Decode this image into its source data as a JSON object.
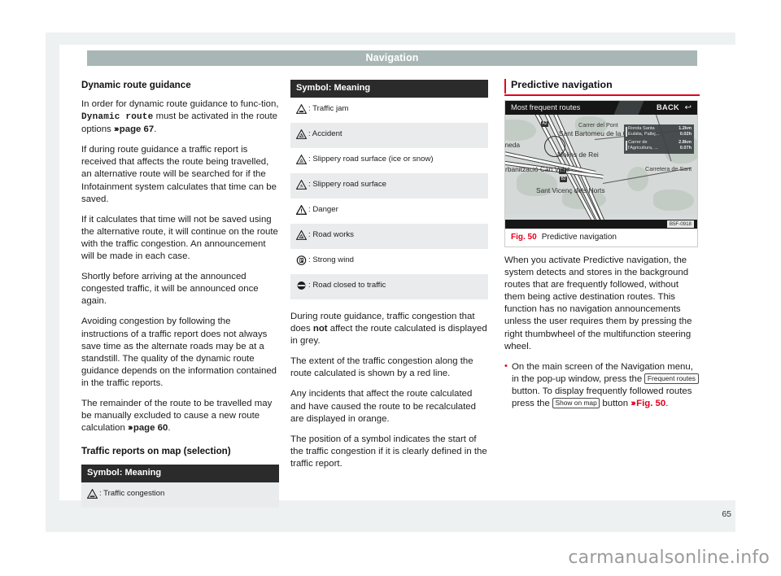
{
  "header": {
    "title": "Navigation"
  },
  "page_number": "65",
  "watermark": "carmanualsonline.info",
  "left_column": {
    "heading": "Dynamic route guidance",
    "para1_a": "In order for dynamic route guidance to func-tion, ",
    "para1_mono": "Dynamic route",
    "para1_b": " must be activated in the route options ",
    "para1_ref": "page 67",
    "para1_end": ".",
    "para2": "If during route guidance a traffic report is received that affects the route being travelled, an alternative route will be searched for if the Infotainment system calculates that time can be saved.",
    "para3": "If it calculates that time will not be saved using the alternative route, it will continue on the route with the traffic congestion. An announcement will be made in each case.",
    "para4": "Shortly before arriving at the announced congested traffic, it will be announced once again.",
    "para5": "Avoiding congestion by following the instructions of a traffic report does not always save time as the alternate roads may be at a standstill. The quality of the dynamic route guidance depends on the information contained in the traffic reports.",
    "para6_a": "The remainder of the route to be travelled may be manually excluded to cause a new route calculation ",
    "para6_ref": "page 60",
    "para6_end": ".",
    "table_heading": "Traffic reports on map (selection)",
    "table": {
      "header": "Symbol: Meaning",
      "rows": [
        {
          "icon": "warning-triangle-congestion-icon",
          "label": ": Traffic congestion"
        }
      ]
    }
  },
  "middle_column": {
    "table": {
      "header": "Symbol: Meaning",
      "rows": [
        {
          "icon": "warning-triangle-traffic-jam-icon",
          "label": ": Traffic jam"
        },
        {
          "icon": "warning-triangle-accident-icon",
          "label": ": Accident"
        },
        {
          "icon": "warning-triangle-ice-snow-icon",
          "label": ": Slippery road surface (ice or snow)"
        },
        {
          "icon": "warning-triangle-slippery-icon",
          "label": ": Slippery road surface"
        },
        {
          "icon": "warning-triangle-danger-icon",
          "label": ": Danger"
        },
        {
          "icon": "warning-triangle-road-works-icon",
          "label": ": Road works"
        },
        {
          "icon": "strong-wind-icon",
          "label": ": Strong wind"
        },
        {
          "icon": "road-closed-icon",
          "label": ": Road closed to traffic"
        }
      ]
    },
    "para1_a": "During route guidance, traffic congestion that does ",
    "para1_bold": "not",
    "para1_b": " affect the route calculated is displayed in grey.",
    "para2": "The extent of the traffic congestion along the route calculated is shown by a red line.",
    "para3": "Any incidents that affect the route calculated and have caused the route to be recalculated are displayed in orange.",
    "para4": "The position of a symbol indicates the start of the traffic congestion if it is clearly defined in the traffic report."
  },
  "right_column": {
    "heading": "Predictive navigation",
    "figure": {
      "screen_title": "Most frequent routes",
      "back_label": "BACK",
      "back_icon": "back-arrow-icon",
      "image_id": "B5F-0918",
      "caption_number": "Fig. 50",
      "caption_text": "Predictive navigation",
      "map_labels": [
        "Carrer del Pont",
        "Sant Bartomeu de la Quadra",
        "Molins de Rei",
        "Sant Vicenç dels Horts",
        "Carretera de Sant",
        "Urbanització Can Vidal",
        "Pineda"
      ],
      "route_entries": [
        {
          "name_line1": "Ronda Santa",
          "name_line2": "Eulàlia, Pallej...",
          "dist": "1.2km",
          "time": "0.02h"
        },
        {
          "name_line1": "Carrer de",
          "name_line2": "l'Agricultura, ...",
          "dist": "2.8km",
          "time": "0.07h"
        }
      ]
    },
    "para1": "When you activate Predictive navigation, the system detects and stores in the background routes that are frequently followed, without them being active destination routes. This function has no navigation announcements unless the user requires them by pressing the right thumbwheel of the multifunction steering wheel.",
    "bullet1_a": "On the main screen of the Navigation menu, in the pop-up window, press the ",
    "bullet1_key1": "Frequent routes",
    "bullet1_b": " button. To display frequently followed routes press the ",
    "bullet1_key2": "Show on map",
    "bullet1_c": " button ",
    "bullet1_ref": "Fig. 50",
    "bullet1_end": "."
  }
}
